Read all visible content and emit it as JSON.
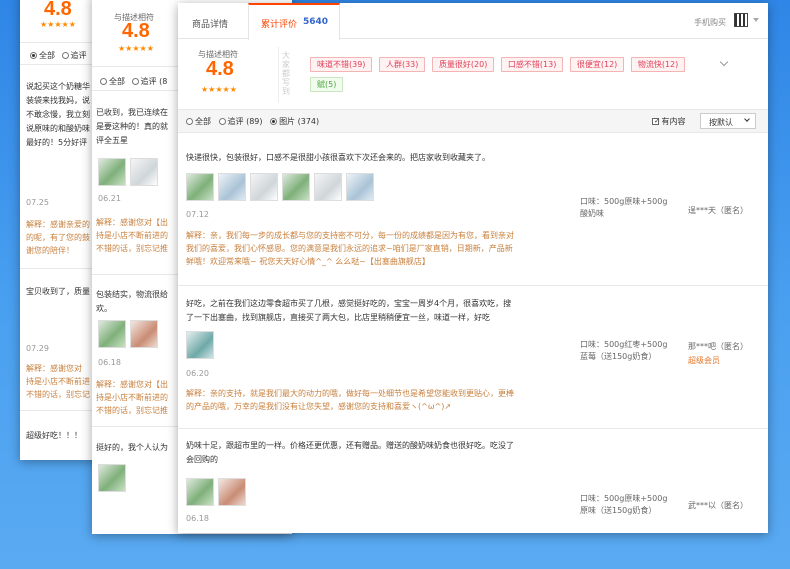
{
  "back1": {
    "rating": "4.8",
    "stars": "★★★★★",
    "filter_all": "全部",
    "filter_good": "追评",
    "review1": "说起买这个奶糖华",
    "review1_l2": "装袋来找我妈，说",
    "review1_l3": "不敢念慢，我立刻",
    "review1_l4": "说原味的和酸奶味",
    "review1_l5": "最好的！5分好评",
    "date1": "07.25",
    "reply1": "解释：感谢亲爱的",
    "reply1_l2": "的呢，有了您的鼓",
    "reply1_l3": "谢您的陪伴！",
    "review2": "宝贝收到了，质量",
    "date2": "07.29",
    "reply2": "解释：感谢您对",
    "reply2_l2": "持是小店不断前进",
    "reply2_l3": "不错的话，别忘记",
    "review3": "超级好吃！！！"
  },
  "back2": {
    "match_label": "与描述相符",
    "rating": "4.8",
    "stars": "★★★★★",
    "filter_all": "全部",
    "filter_good": "追评 (8",
    "review1": "已收到，我已连续在",
    "review1_l2": "是要这种的！真的就",
    "review1_l3": "评全五星",
    "date1": "06.21",
    "reply1": "解释：感谢您对【出",
    "reply1_l2": "持是小店不断前进的",
    "reply1_l3": "不错的话，别忘记推",
    "review2": "包装结实，物流很给",
    "review2_l2": "欢。",
    "date2": "06.18",
    "reply2": "解释：感谢您对【出",
    "reply2_l2": "持是小店不断前进的",
    "reply2_l3": "不错的话，别忘记推",
    "review3": "挺好的，我个人认为"
  },
  "front": {
    "tabs": [
      {
        "label": "商品详情"
      },
      {
        "label": "累计评价",
        "count": "5640"
      }
    ],
    "mobile_buy": "手机购买",
    "match_label": "与描述相符",
    "rating": "4.8",
    "stars": "★★★★★",
    "impression_label": "大家都写到",
    "tags": [
      {
        "label": "味道不错(39)"
      },
      {
        "label": "人群(33)"
      },
      {
        "label": "质量很好(20)"
      },
      {
        "label": "口感不错(13)"
      },
      {
        "label": "很便宜(12)"
      },
      {
        "label": "物流快(12)"
      },
      {
        "label": "赋(5)"
      }
    ],
    "filters": {
      "all": "全部",
      "follow": "追评 (89)",
      "pictures": "图片 (374)"
    },
    "has_content": "有内容",
    "sort": "按默认",
    "reviews": [
      {
        "text": "快递很快，包装很好，口感不是很甜小孩很喜欢下次还会来的。把店家收到收藏夹了。",
        "date": "07.12",
        "sku_line1": "口味：500g原味+500g",
        "sku_line2": "酸奶味",
        "user": "逞***天（匿名）",
        "reply_l1": "解释：亲，我们每一步的成长都与您的支持密不可分，每一份的成绩都是因为有您，看到亲对",
        "reply_l2": "我们的喜爱，我们心怀感恩。您的满意是我们永远的追求~咱们是厂家直销，日期新，产品新",
        "reply_l3": "鲜哦！欢迎常来哦~ 祝您天天好心情^_^ 么么哒~【出塞曲旗舰店】"
      },
      {
        "text_l1": "好吃，之前在我们这边零食超市买了几根，感觉挺好吃的，宝宝一周岁4个月，很喜欢吃，搜",
        "text_l2": "了一下出塞曲，找到旗舰店，直接买了两大包，比店里稍稍便宜一丝，味道一样，好吃",
        "date": "06.20",
        "sku_line1": "口味：500g红枣+500g",
        "sku_line2": "蓝莓（送150g奶食）",
        "user": "那***吧（匿名）",
        "member": "超级会员",
        "reply_l1": "解释：亲的支持，就是我们最大的动力的哦，做好每一处细节也是希望您能收到更贴心，更棒",
        "reply_l2": "的产品的哦，万幸的是我们没有让您失望，感谢您的支持和喜爱ヽ(^ω^)↗"
      },
      {
        "text_l1": "奶味十足，跟超市里的一样。价格还更优惠，还有赠品。赠送的酸奶味奶食也很好吃。吃没了",
        "text_l2": "会回购的",
        "date": "06.18",
        "sku_line1": "口味：500g原味+500g",
        "sku_line2": "原味（送150g奶食）",
        "user": "武***以（匿名）"
      }
    ]
  }
}
